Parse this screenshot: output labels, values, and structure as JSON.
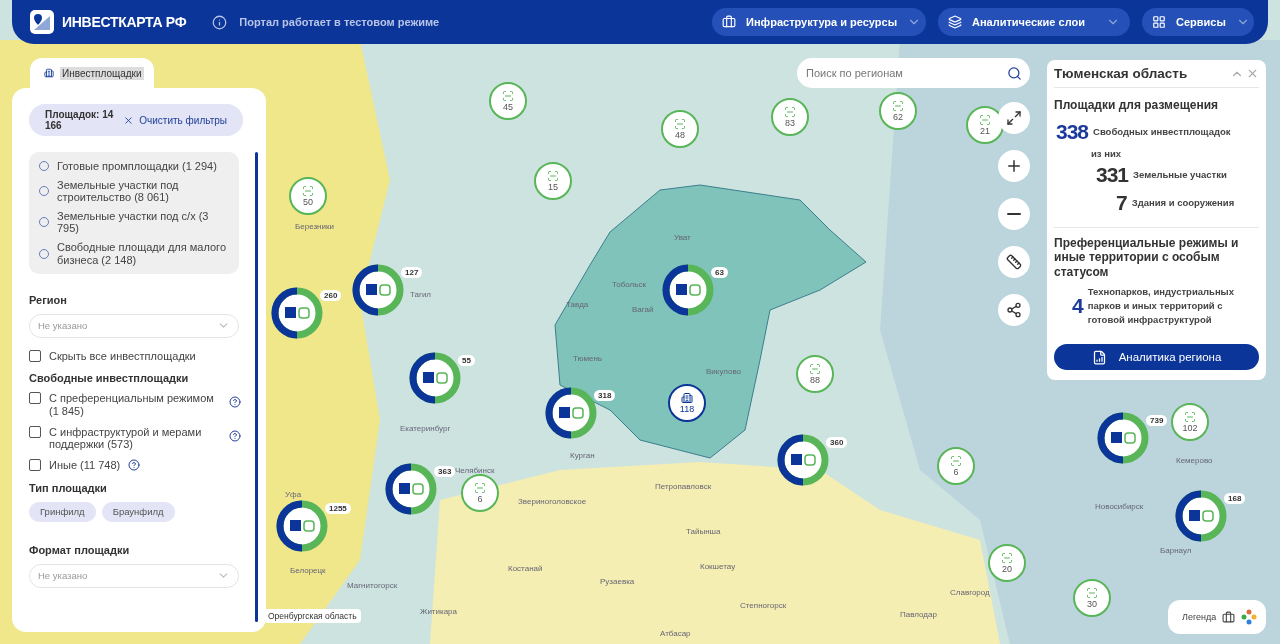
{
  "header": {
    "logo_text": "ИНВЕСТКАРТА РФ",
    "notice": "Портал работает в тестовом режиме",
    "menus": [
      {
        "label": "Инфраструктура и ресурсы"
      },
      {
        "label": "Аналитические слои"
      },
      {
        "label": "Сервисы"
      }
    ]
  },
  "left_panel": {
    "tab": "Инвестплощадки",
    "count_label": "Площадок: 14 166",
    "clear_label": "Очистить фильтры",
    "categories": [
      {
        "label": "Готовые промплощадки (1 294)",
        "selected": false
      },
      {
        "label": "Земельные участки под строительство (8 061)",
        "selected": false
      },
      {
        "label": "Земельные участки под с/х (3 795)",
        "selected": false
      },
      {
        "label": "Свободные площади для малого бизнеса (2 148)",
        "selected": false
      }
    ],
    "region": {
      "title": "Регион",
      "placeholder": "Не указано"
    },
    "hide_all": {
      "label": "Скрыть все инвестплощадки",
      "checked": false
    },
    "free": {
      "title": "Свободные инвестплощадки",
      "options": [
        {
          "label": "С преференциальным режимом (1 845)",
          "checked": false
        },
        {
          "label": "С инфраструктурой и мерами поддержки (573)",
          "checked": false
        },
        {
          "label": "Иные (11 748)",
          "checked": false
        }
      ]
    },
    "type": {
      "title": "Тип площадки",
      "chips": [
        {
          "label": "Гринфилд",
          "selected": false
        },
        {
          "label": "Браунфилд",
          "selected": false
        }
      ]
    },
    "format": {
      "title": "Формат площадки",
      "placeholder": "Не указано"
    }
  },
  "search": {
    "placeholder": "Поиск по регионам"
  },
  "region_card": {
    "title": "Тюменская область",
    "section_title": "Площадки для размещения",
    "main": {
      "value": "338",
      "label": "Свободных инвестплощадок"
    },
    "sub_note": "из них",
    "sub": [
      {
        "value": "331",
        "label": "Земельные участки"
      },
      {
        "value": "7",
        "label": "Здания и сооружения"
      }
    ],
    "pref_title": "Преференциальные режимы и иные территории с особым статусом",
    "pref": {
      "value": "4",
      "label": "Технопарков, индустриальных парков и иных территорий с готовой инфраструктурой"
    },
    "button": "Аналитика региона"
  },
  "map_labels": [
    "Тобольск",
    "Тюмень",
    "Курган",
    "Вагай",
    "Викулово",
    "Уват",
    "Тавда",
    "Тагил",
    "Екатеринбург",
    "Челябинск",
    "Уфа",
    "Магнитогорск",
    "Белорецк",
    "Петропавловск",
    "Тайынша",
    "Кокшетау",
    "Степногорск",
    "Костанай",
    "Рузаевка",
    "Павлодар",
    "Атбасар",
    "Житикара",
    "Новосибирск",
    "Кемерово",
    "Барнаул",
    "Славгород",
    "Звериноголовское",
    "Березники"
  ],
  "region_tag": "Оренбургская область",
  "markers": [
    {
      "kind": "cluster",
      "count": "45"
    },
    {
      "kind": "cluster",
      "count": "48"
    },
    {
      "kind": "cluster",
      "count": "83"
    },
    {
      "kind": "cluster",
      "count": "62"
    },
    {
      "kind": "cluster",
      "count": "21"
    },
    {
      "kind": "cluster",
      "count": "15"
    },
    {
      "kind": "cluster",
      "count": "50"
    },
    {
      "kind": "cluster",
      "count": "88"
    },
    {
      "kind": "cluster",
      "count": "6"
    },
    {
      "kind": "cluster",
      "count": "6"
    },
    {
      "kind": "cluster",
      "count": "102"
    },
    {
      "kind": "cluster",
      "count": "20"
    },
    {
      "kind": "cluster",
      "count": "30"
    },
    {
      "kind": "donut",
      "count": "127"
    },
    {
      "kind": "donut",
      "count": "260"
    },
    {
      "kind": "donut",
      "count": "55"
    },
    {
      "kind": "donut",
      "count": "63"
    },
    {
      "kind": "donut",
      "count": "318"
    },
    {
      "kind": "donut",
      "count": "360"
    },
    {
      "kind": "donut",
      "count": "739"
    },
    {
      "kind": "donut",
      "count": "363"
    },
    {
      "kind": "donut",
      "count": "1255"
    },
    {
      "kind": "donut",
      "count": "168"
    },
    {
      "kind": "building",
      "count": "118"
    }
  ],
  "legend": {
    "label": "Легенда"
  }
}
